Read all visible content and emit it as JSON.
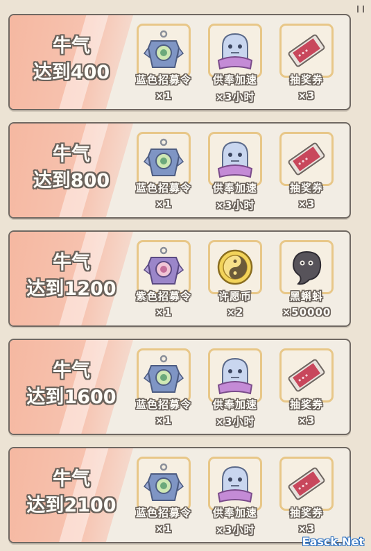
{
  "milestones": [
    {
      "line1": "牛气",
      "line2": "达到400",
      "rewards": [
        {
          "icon": "blue-recruit-token-icon",
          "name": "蓝色招募令",
          "qty": "×1"
        },
        {
          "icon": "ghost-speedup-icon",
          "name": "供奉加速",
          "qty": "×3小时"
        },
        {
          "icon": "lottery-ticket-icon",
          "name": "抽奖券",
          "qty": "×3"
        }
      ]
    },
    {
      "line1": "牛气",
      "line2": "达到800",
      "rewards": [
        {
          "icon": "blue-recruit-token-icon",
          "name": "蓝色招募令",
          "qty": "×1"
        },
        {
          "icon": "ghost-speedup-icon",
          "name": "供奉加速",
          "qty": "×3小时"
        },
        {
          "icon": "lottery-ticket-icon",
          "name": "抽奖券",
          "qty": "×3"
        }
      ]
    },
    {
      "line1": "牛气",
      "line2": "达到1200",
      "rewards": [
        {
          "icon": "purple-recruit-token-icon",
          "name": "紫色招募令",
          "qty": "×1"
        },
        {
          "icon": "wish-coin-icon",
          "name": "许愿币",
          "qty": "×2"
        },
        {
          "icon": "black-tadpole-icon",
          "name": "黑蝌蚪",
          "qty": "×50000"
        }
      ]
    },
    {
      "line1": "牛气",
      "line2": "达到1600",
      "rewards": [
        {
          "icon": "blue-recruit-token-icon",
          "name": "蓝色招募令",
          "qty": "×1"
        },
        {
          "icon": "ghost-speedup-icon",
          "name": "供奉加速",
          "qty": "×3小时"
        },
        {
          "icon": "lottery-ticket-icon",
          "name": "抽奖券",
          "qty": "×3"
        }
      ]
    },
    {
      "line1": "牛气",
      "line2": "达到2100",
      "rewards": [
        {
          "icon": "blue-recruit-token-icon",
          "name": "蓝色招募令",
          "qty": "×1"
        },
        {
          "icon": "ghost-speedup-icon",
          "name": "供奉加速",
          "qty": "×3小时"
        },
        {
          "icon": "lottery-ticket-icon",
          "name": "抽奖券",
          "qty": "×3"
        }
      ]
    }
  ],
  "watermark": "Easck.Net",
  "colors": {
    "panel_bg": "#f2ede4",
    "panel_border": "#6f6862",
    "stripe": "#f5b8a1",
    "item_border": "#e8c788",
    "text_outline": "#6a625b"
  }
}
